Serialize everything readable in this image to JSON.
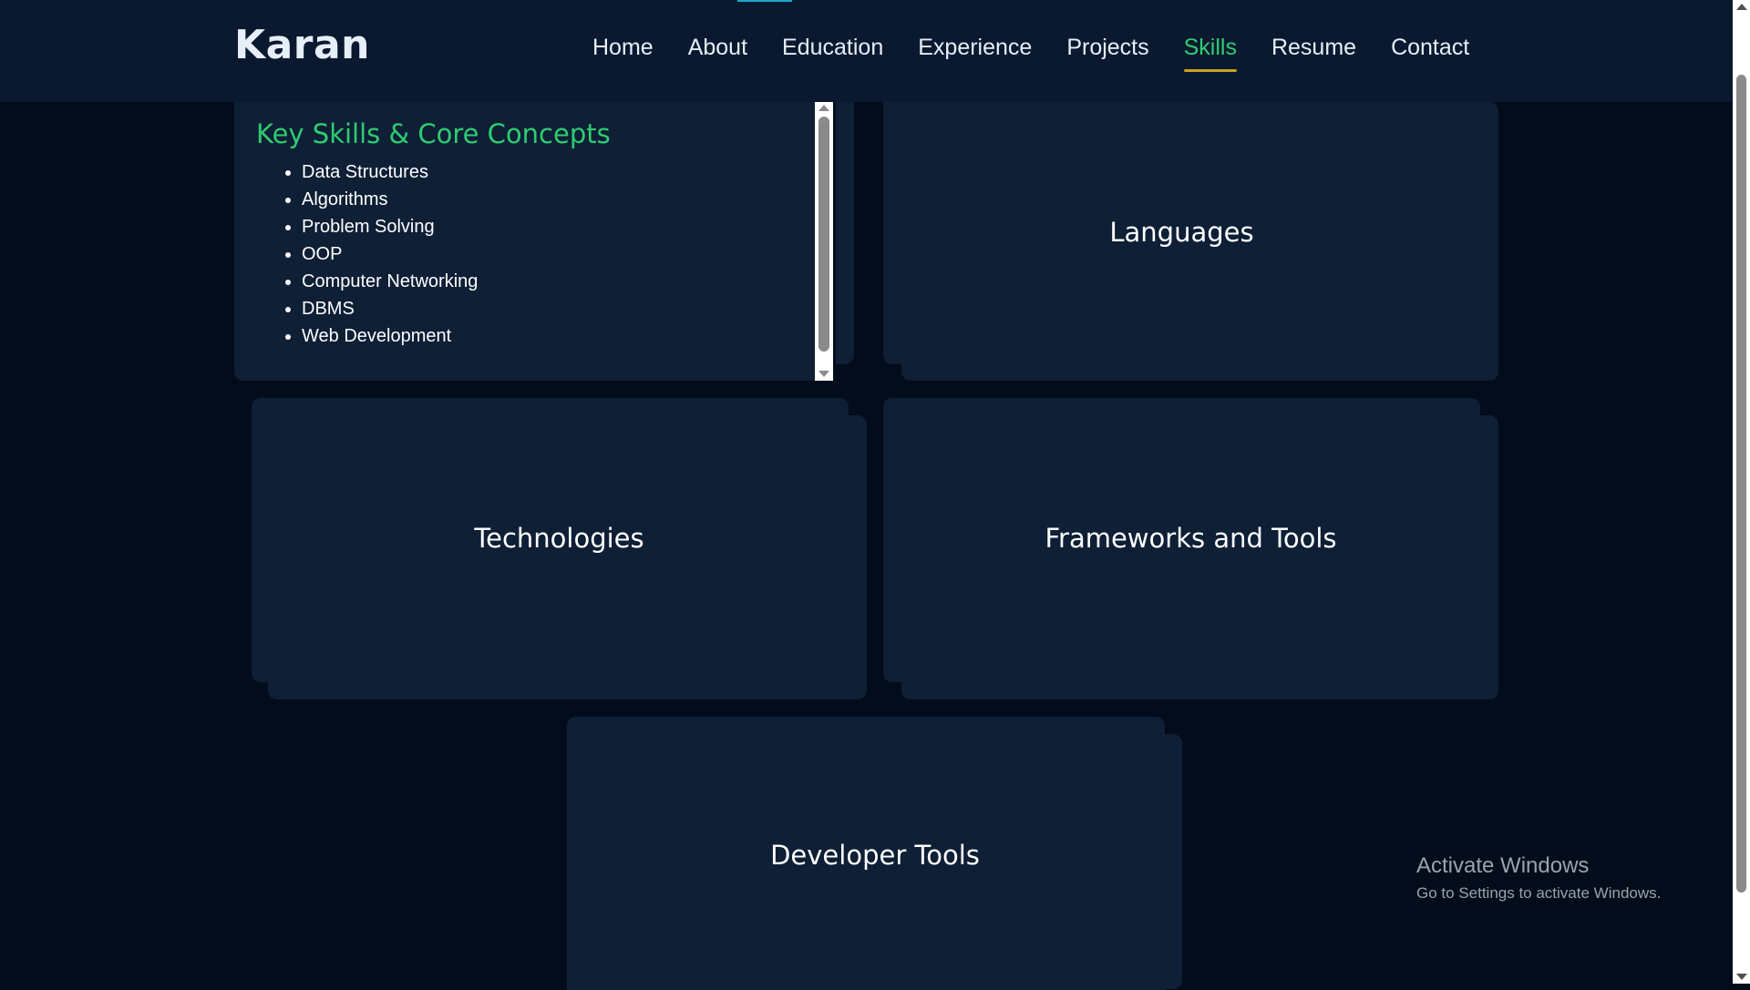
{
  "header": {
    "logo": "Karan",
    "nav": [
      {
        "label": "Home",
        "active": false
      },
      {
        "label": "About",
        "active": false
      },
      {
        "label": "Education",
        "active": false
      },
      {
        "label": "Experience",
        "active": false
      },
      {
        "label": "Projects",
        "active": false
      },
      {
        "label": "Skills",
        "active": true
      },
      {
        "label": "Resume",
        "active": false
      },
      {
        "label": "Contact",
        "active": false
      }
    ]
  },
  "skills": {
    "title": "Key Skills & Core Concepts",
    "items": [
      "Data Structures",
      "Algorithms",
      "Problem Solving",
      "OOP",
      "Computer Networking",
      "DBMS",
      "Web Development"
    ]
  },
  "cards": {
    "languages": "Languages",
    "technologies": "Technologies",
    "frameworks": "Frameworks and Tools",
    "devtools": "Developer Tools"
  },
  "watermark": {
    "title": "Activate Windows",
    "subtitle": "Go to Settings to activate Windows."
  },
  "colors": {
    "page_bg": "#020c1b",
    "navbar_bg": "#0a192f",
    "card_bg": "#0e1f36",
    "accent_green": "#2ecc71",
    "underline_gold": "#c9a227",
    "progress_teal": "#1aa7c9"
  }
}
